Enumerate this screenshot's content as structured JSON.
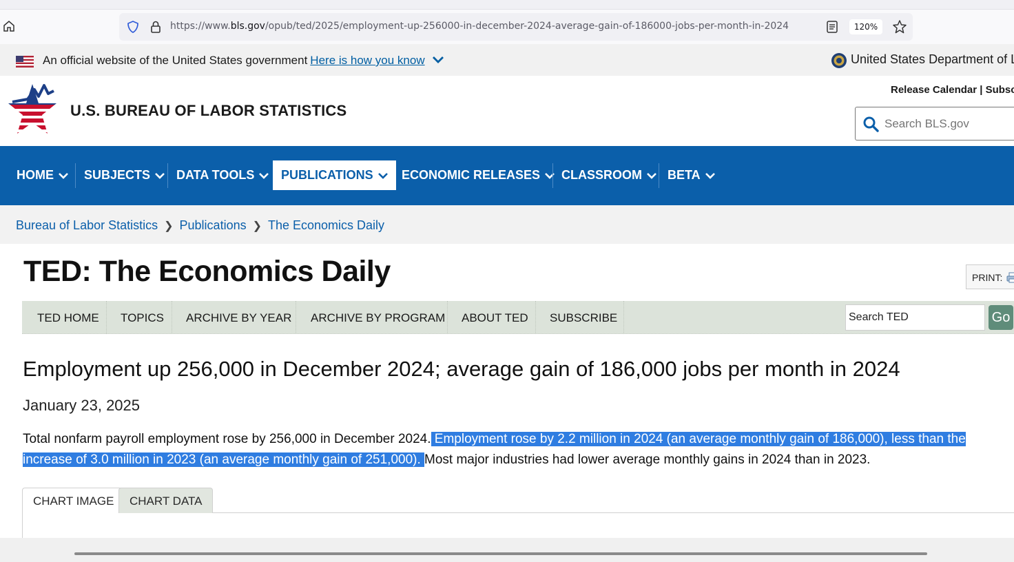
{
  "browser": {
    "url_prefix": "https://www.",
    "url_domain": "bls.gov",
    "url_path": "/opub/ted/2025/employment-up-256000-in-december-2024-average-gain-of-186000-jobs-per-month-in-2024",
    "zoom": "120%"
  },
  "gov_banner": {
    "text": "An official website of the United States government",
    "link": "Here is how you know",
    "department": "United States Department of Labor"
  },
  "header": {
    "title": "U.S. BUREAU OF LABOR STATISTICS",
    "util_links": "Release Calendar | Subscribe",
    "search_placeholder": "Search BLS.gov"
  },
  "nav": {
    "items": [
      "HOME",
      "SUBJECTS",
      "DATA TOOLS",
      "PUBLICATIONS",
      "ECONOMIC RELEASES",
      "CLASSROOM",
      "BETA"
    ],
    "active": "PUBLICATIONS"
  },
  "breadcrumb": [
    "Bureau of Labor Statistics",
    "Publications",
    "The Economics Daily"
  ],
  "ted": {
    "title": "TED: The Economics Daily",
    "print_label": "PRINT:",
    "nav": [
      "TED HOME",
      "TOPICS",
      "ARCHIVE BY YEAR",
      "ARCHIVE BY PROGRAM",
      "ABOUT TED",
      "SUBSCRIBE"
    ],
    "search_value": "Search TED",
    "go_label": "Go"
  },
  "article": {
    "title": "Employment up 256,000 in December 2024; average gain of 186,000 jobs per month in 2024",
    "date": "January 23, 2025",
    "body_plain_1": "Total nonfarm payroll employment rose by 256,000 in December 2024.",
    "body_hl_1": " Employment rose by 2.2 million in 2024 (an average monthly gain of 186,000), less than the",
    "body_hl_2": "increase of 3.0 million in 2023 (an average monthly gain of 251,000). ",
    "body_plain_2": "Most major industries had lower average monthly gains in 2024 than in 2023."
  },
  "tabs": [
    "CHART IMAGE",
    "CHART DATA"
  ],
  "colors": {
    "nav_blue": "#0b5faa",
    "ted_nav_bg": "#dce3da",
    "highlight": "#2f7de1",
    "go_button": "#5f8c7a"
  }
}
